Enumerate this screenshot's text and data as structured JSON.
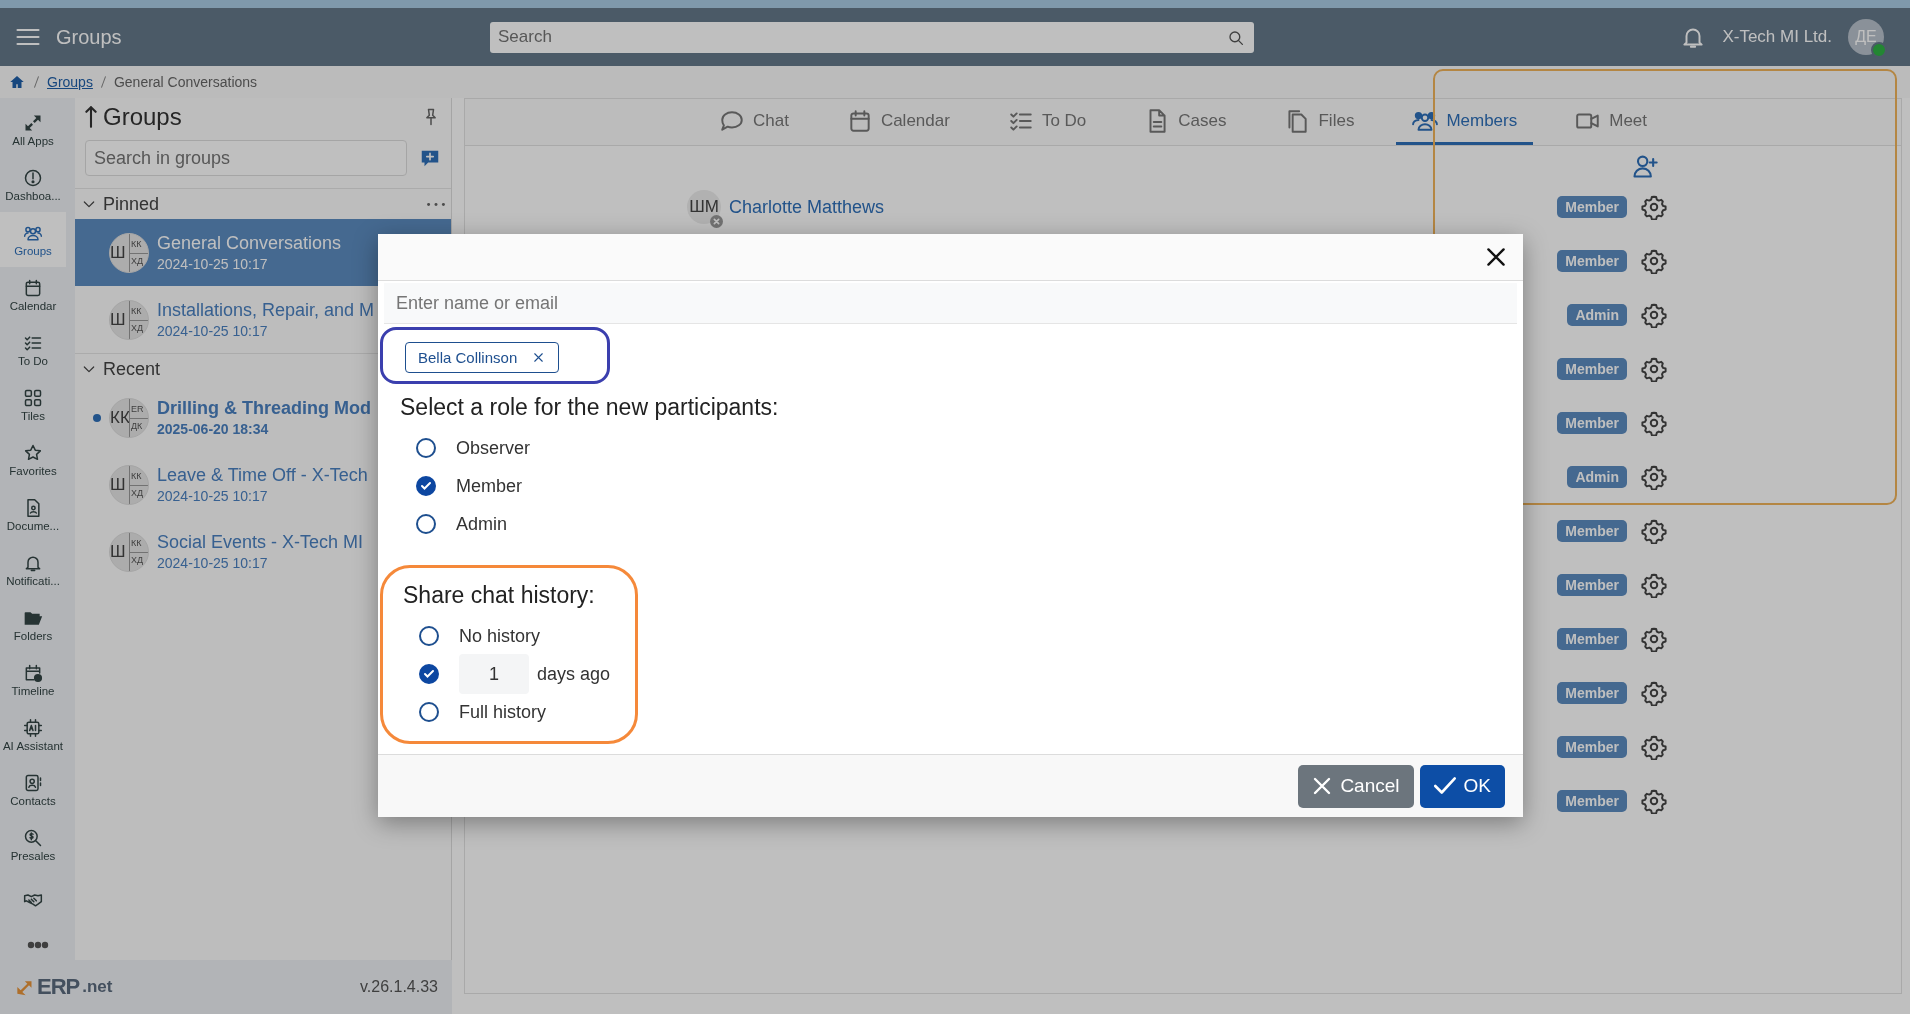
{
  "header": {
    "title": "Groups",
    "search": {
      "placeholder": "Search"
    },
    "company": "X-Tech MI Ltd.",
    "avatar": "ДЕ",
    "online": true
  },
  "breadcrumb": [
    {
      "label": "Groups",
      "link": true
    },
    {
      "label": "General Conversations",
      "link": false
    }
  ],
  "nav": [
    {
      "label": "All Apps",
      "selected": false
    },
    {
      "label": "Dashboa...",
      "selected": false
    },
    {
      "label": "Groups",
      "selected": true
    },
    {
      "label": "Calendar",
      "selected": false
    },
    {
      "label": "To Do",
      "selected": false
    },
    {
      "label": "Tiles",
      "selected": false
    },
    {
      "label": "Favorites",
      "selected": false
    },
    {
      "label": "Docume...",
      "selected": false
    },
    {
      "label": "Notificati...",
      "selected": false
    },
    {
      "label": "Folders",
      "selected": false
    },
    {
      "label": "Timeline",
      "selected": false
    },
    {
      "label": "AI Assistant",
      "selected": false
    },
    {
      "label": "Contacts",
      "selected": false
    },
    {
      "label": "Presales",
      "selected": false
    },
    {
      "selected": false
    }
  ],
  "groups_panel": {
    "title": "Groups",
    "search": {
      "placeholder": "Search in groups"
    },
    "sections": [
      {
        "title": "Pinned",
        "expanded": true,
        "more": true,
        "items": [
          {
            "name": "General Conversations",
            "time": "2024-10-25 10:17",
            "selected": true,
            "unread": false,
            "avatar": {
              "main": "Ш",
              "top": "КК",
              "bottom": "ХД"
            }
          },
          {
            "name": "Installations, Repair, and M",
            "time": "2024-10-25 10:17",
            "selected": false,
            "unread": false,
            "avatar": {
              "main": "Ш",
              "top": "КК",
              "bottom": "ХД"
            }
          }
        ]
      },
      {
        "title": "Recent",
        "expanded": true,
        "more": false,
        "items": [
          {
            "name": "Drilling & Threading Mod",
            "time": "2025-06-20 18:34",
            "selected": false,
            "unread": true,
            "avatar": {
              "main": "КК",
              "top": "ER",
              "bottom": "ДК"
            }
          },
          {
            "name": "Leave & Time Off - X-Tech",
            "time": "2024-10-25 10:17",
            "selected": false,
            "unread": false,
            "avatar": {
              "main": "Ш",
              "top": "КК",
              "bottom": "ХД"
            }
          },
          {
            "name": "Social Events - X-Tech MI",
            "time": "2024-10-25 10:17",
            "selected": false,
            "unread": false,
            "avatar": {
              "main": "Ш",
              "top": "КК",
              "bottom": "ХД"
            }
          }
        ]
      }
    ]
  },
  "footer": {
    "logo_main": "ERP",
    "logo_suffix": ".net",
    "version": "v.26.1.4.33"
  },
  "tabs": [
    {
      "label": "Chat",
      "selected": false
    },
    {
      "label": "Calendar",
      "selected": false
    },
    {
      "label": "To Do",
      "selected": false
    },
    {
      "label": "Cases",
      "selected": false
    },
    {
      "label": "Files",
      "selected": false
    },
    {
      "label": "Members",
      "selected": true
    },
    {
      "label": "Meet",
      "selected": false
    }
  ],
  "members": [
    {
      "name": "Charlotte Matthews",
      "initials": "ШМ",
      "role": "Member"
    },
    {
      "role": "Member"
    },
    {
      "role": "Admin"
    },
    {
      "role": "Member"
    },
    {
      "role": "Member"
    },
    {
      "role": "Admin"
    },
    {
      "role": "Member"
    },
    {
      "role": "Member"
    },
    {
      "role": "Member"
    },
    {
      "role": "Member"
    },
    {
      "role": "Member"
    },
    {
      "role": "Member"
    }
  ],
  "dialog": {
    "input": {
      "placeholder": "Enter name or email"
    },
    "chips": [
      "Bella Collinson"
    ],
    "role_title": "Select a role for the new participants:",
    "roles": [
      {
        "label": "Observer",
        "selected": false
      },
      {
        "label": "Member",
        "selected": true
      },
      {
        "label": "Admin",
        "selected": false
      }
    ],
    "history_title": "Share chat history:",
    "history": [
      {
        "kind": "plain",
        "label": "No history",
        "selected": false
      },
      {
        "kind": "days",
        "value": "1",
        "label": "days ago",
        "selected": true
      },
      {
        "kind": "plain",
        "label": "Full history",
        "selected": false
      }
    ],
    "buttons": [
      {
        "kind": "cancel",
        "label": "Cancel"
      },
      {
        "kind": "ok",
        "label": "OK"
      }
    ]
  }
}
